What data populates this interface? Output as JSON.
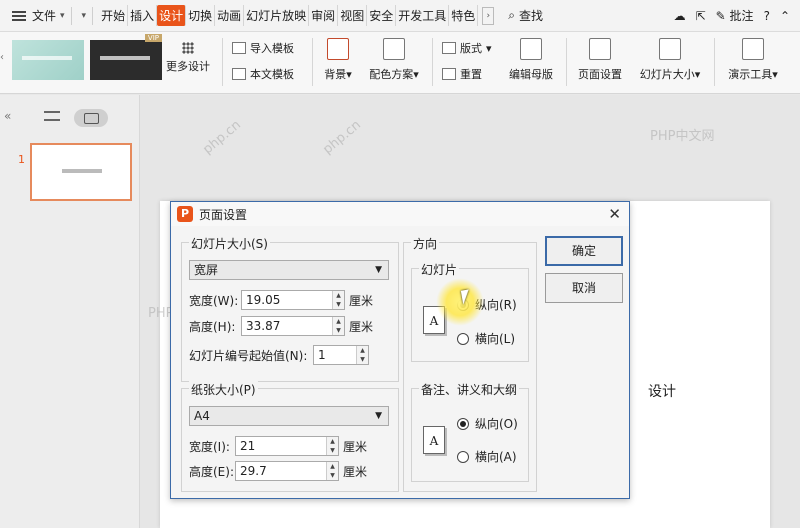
{
  "menubar": {
    "file_label": "文件",
    "tabs": [
      "开始",
      "插入",
      "设计",
      "切换",
      "动画",
      "幻灯片放映",
      "审阅",
      "视图",
      "安全",
      "开发工具",
      "特色"
    ],
    "active_tab": "设计",
    "search_label": "查找",
    "comment_label": "批注",
    "help": "?",
    "minimize": "⌃"
  },
  "ribbon": {
    "vip_badge": "VIP",
    "more_design": "更多设计",
    "import_template": "导入模板",
    "text_template": "本文模板",
    "background": "背景",
    "color_scheme": "配色方案",
    "layout": "版式",
    "reset": "重置",
    "edit_master": "编辑母版",
    "page_setup": "页面设置",
    "slide_size": "幻灯片大小",
    "presentation_tools": "演示工具"
  },
  "left_panel": {
    "slide_number": "1"
  },
  "slide": {
    "visible_text": "设计"
  },
  "watermarks": [
    "PHP中文网",
    "php.cn"
  ],
  "dialog": {
    "title": "页面设置",
    "close": "✕",
    "slide_size_group": "幻灯片大小(S)",
    "slide_size_value": "宽屏",
    "width_label": "宽度(W):",
    "width_value": "19.05",
    "height_label": "高度(H):",
    "height_value": "33.87",
    "unit": "厘米",
    "start_number_label": "幻灯片编号起始值(N):",
    "start_number_value": "1",
    "paper_group": "纸张大小(P)",
    "paper_value": "A4",
    "paper_width_label": "宽度(I):",
    "paper_width_value": "21",
    "paper_height_label": "高度(E):",
    "paper_height_value": "29.7",
    "orientation_group": "方向",
    "slides_group": "幻灯片",
    "notes_group": "备注、讲义和大纲",
    "portrait": "纵向(R)",
    "landscape": "横向(L)",
    "notes_portrait": "纵向(O)",
    "notes_landscape": "横向(A)",
    "page_icon_letter": "A",
    "ok": "确定",
    "cancel": "取消"
  }
}
